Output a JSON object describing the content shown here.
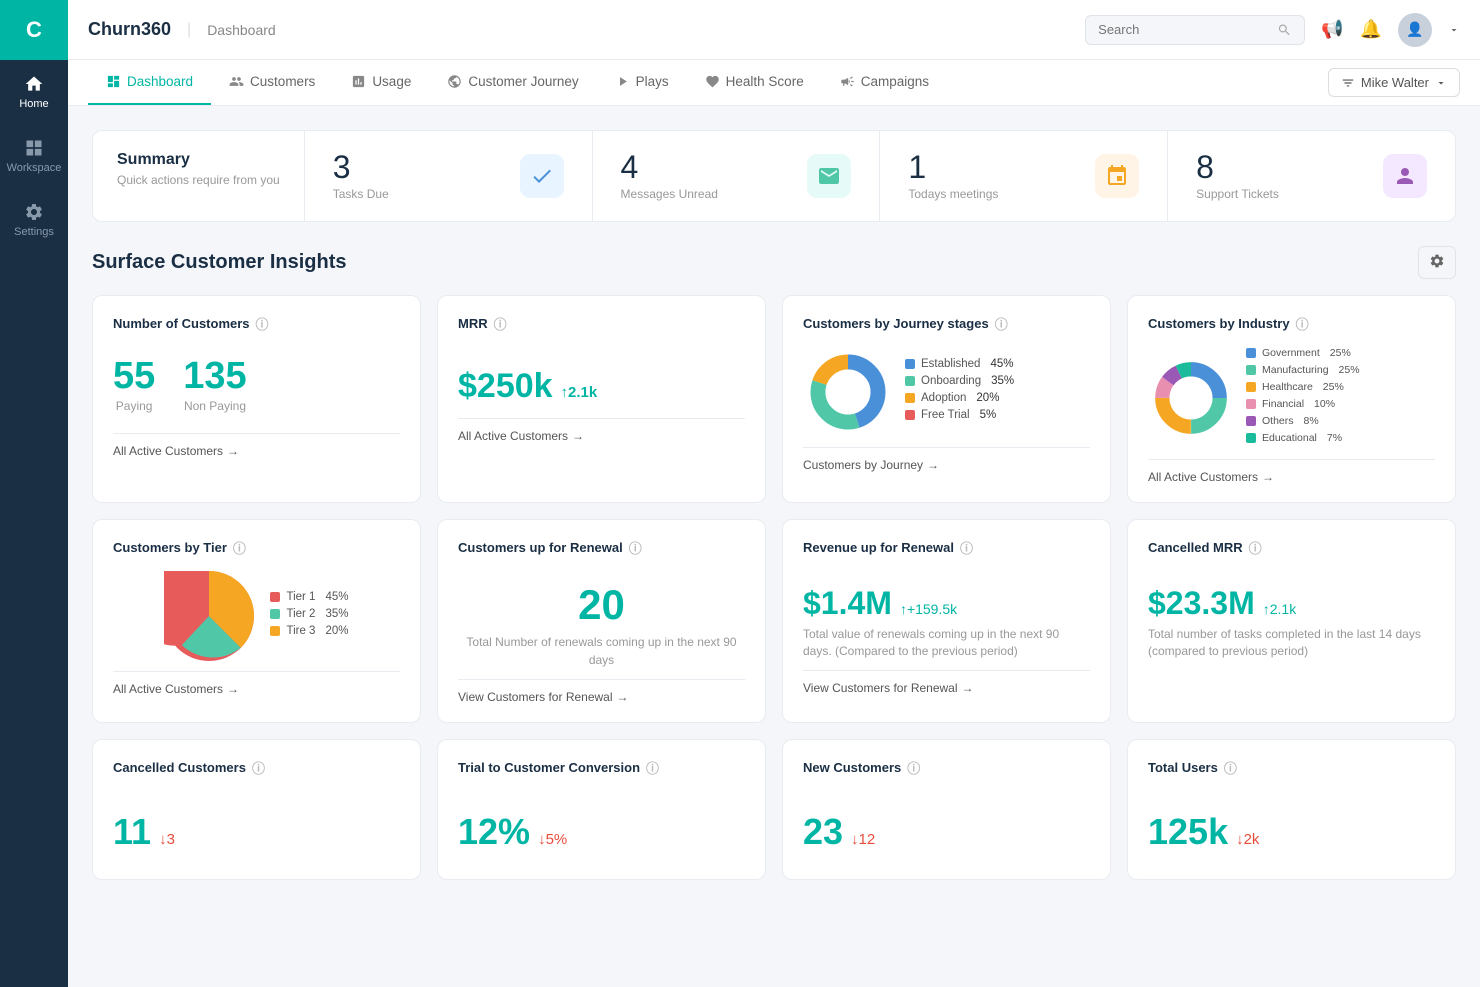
{
  "app": {
    "name": "Churn360",
    "logo_letter": "C",
    "page": "Dashboard"
  },
  "sidebar": {
    "items": [
      {
        "label": "Home",
        "icon": "home",
        "active": true
      },
      {
        "label": "Workspace",
        "icon": "workspace",
        "active": false
      },
      {
        "label": "Settings",
        "icon": "settings",
        "active": false
      }
    ]
  },
  "topbar": {
    "search_placeholder": "Search",
    "user_name": "Mike Walter"
  },
  "nav": {
    "tabs": [
      {
        "label": "Dashboard",
        "active": true
      },
      {
        "label": "Customers",
        "active": false
      },
      {
        "label": "Usage",
        "active": false
      },
      {
        "label": "Customer Journey",
        "active": false
      },
      {
        "label": "Plays",
        "active": false
      },
      {
        "label": "Health Score",
        "active": false
      },
      {
        "label": "Campaigns",
        "active": false
      }
    ],
    "user_filter": "Mike Walter"
  },
  "summary": {
    "title": "Summary",
    "subtitle": "Quick actions require from you",
    "cards": [
      {
        "num": "3",
        "label": "Tasks Due",
        "icon_type": "blue",
        "icon": "✓"
      },
      {
        "num": "4",
        "label": "Messages Unread",
        "icon_type": "green",
        "icon": "✉"
      },
      {
        "num": "1",
        "label": "Todays meetings",
        "icon_type": "orange",
        "icon": "📅"
      },
      {
        "num": "8",
        "label": "Support Tickets",
        "icon_type": "purple",
        "icon": "👤"
      }
    ]
  },
  "insights": {
    "title": "Surface Customer Insights",
    "rows": [
      {
        "cards": [
          {
            "id": "num-customers",
            "title": "Number of Customers",
            "paying": "55",
            "paying_label": "Paying",
            "non_paying": "135",
            "non_paying_label": "Non Paying",
            "link": "All Active Customers"
          },
          {
            "id": "mrr",
            "title": "MRR",
            "value": "$250k",
            "trend": "↑2.1k",
            "link": "All Active Customers"
          },
          {
            "id": "journey-stages",
            "title": "Customers by Journey stages",
            "legend": [
              {
                "label": "Established",
                "pct": "45%",
                "color": "#4A90D9"
              },
              {
                "label": "Onboarding",
                "pct": "35%",
                "color": "#50C8A8"
              },
              {
                "label": "Adoption",
                "pct": "20%",
                "color": "#F5A623"
              },
              {
                "label": "Free Trial",
                "pct": "5%",
                "color": "#E85B5B"
              }
            ],
            "link": "Customers by Journey",
            "donut_segments": [
              {
                "pct": 45,
                "color": "#4A90D9"
              },
              {
                "pct": 35,
                "color": "#50C8A8"
              },
              {
                "pct": 20,
                "color": "#F5A623"
              },
              {
                "pct": 5,
                "color": "#E85B5B"
              }
            ]
          },
          {
            "id": "industry",
            "title": "Customers by Industry",
            "legend": [
              {
                "label": "Government",
                "pct": "25%",
                "color": "#4A90D9"
              },
              {
                "label": "Manufacturing",
                "pct": "25%",
                "color": "#50C8A8"
              },
              {
                "label": "Healthcare",
                "pct": "25%",
                "color": "#F5A623"
              },
              {
                "label": "Financial",
                "pct": "10%",
                "color": "#E88FB0"
              },
              {
                "label": "Others",
                "pct": "8%",
                "color": "#9B59B6"
              },
              {
                "label": "Educational",
                "pct": "7%",
                "color": "#1ABC9C"
              }
            ],
            "link": "All Active Customers",
            "donut_segments": [
              {
                "pct": 25,
                "color": "#4A90D9"
              },
              {
                "pct": 25,
                "color": "#50C8A8"
              },
              {
                "pct": 25,
                "color": "#F5A623"
              },
              {
                "pct": 10,
                "color": "#E88FB0"
              },
              {
                "pct": 8,
                "color": "#9B59B6"
              },
              {
                "pct": 7,
                "color": "#1ABC9C"
              }
            ]
          }
        ]
      },
      {
        "cards": [
          {
            "id": "tier",
            "title": "Customers by Tier",
            "legend": [
              {
                "label": "Tier 1",
                "pct": "45%",
                "color": "#E85B5B"
              },
              {
                "label": "Tier 2",
                "pct": "35%",
                "color": "#50C8A8"
              },
              {
                "label": "Tire 3",
                "pct": "20%",
                "color": "#F5A623"
              }
            ],
            "link": "All Active Customers",
            "pie_segments": [
              {
                "pct": 45,
                "color": "#E85B5B"
              },
              {
                "pct": 35,
                "color": "#50C8A8"
              },
              {
                "pct": 20,
                "color": "#F5A623"
              }
            ]
          },
          {
            "id": "renewal",
            "title": "Customers up for Renewal",
            "value": "20",
            "sub": "Total Number of renewals coming up in the next 90 days",
            "link": "View Customers for Renewal"
          },
          {
            "id": "revenue-renewal",
            "title": "Revenue up for Renewal",
            "value": "$1.4M",
            "trend": "↑+159.5k",
            "sub": "Total value of renewals coming up in the next 90 days. (Compared to the previous period)",
            "link": "View Customers for Renewal"
          },
          {
            "id": "cancelled-mrr",
            "title": "Cancelled MRR",
            "value": "$23.3M",
            "trend": "↑2.1k",
            "sub": "Total number of tasks completed in the last 14 days (compared to previous period)",
            "link": ""
          }
        ]
      },
      {
        "cards": [
          {
            "id": "cancelled-customers",
            "title": "Cancelled Customers",
            "value": "11",
            "trend": "↓3",
            "trend_dir": "down"
          },
          {
            "id": "trial-conversion",
            "title": "Trial to Customer Conversion",
            "value": "12%",
            "trend": "↓5%",
            "trend_dir": "down"
          },
          {
            "id": "new-customers",
            "title": "New Customers",
            "value": "23",
            "trend": "↓12",
            "trend_dir": "down"
          },
          {
            "id": "total-users",
            "title": "Total Users",
            "value": "125k",
            "trend": "↓2k",
            "trend_dir": "down"
          }
        ]
      }
    ]
  }
}
